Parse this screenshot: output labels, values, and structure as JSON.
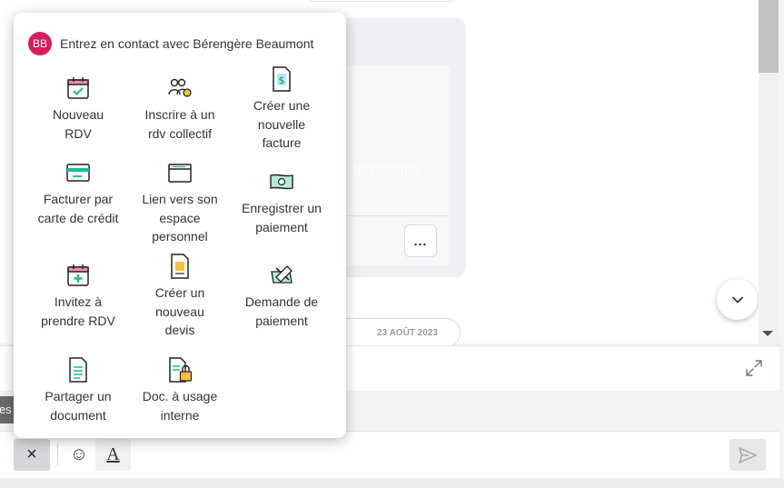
{
  "popup": {
    "avatar_initials": "BB",
    "title": "Entrez en contact avec Bérengère Beaumont",
    "items": [
      {
        "label": "Nouveau RDV",
        "icon": "calendar-check-icon"
      },
      {
        "label": "Inscrire à un rdv collectif",
        "icon": "group-users-icon"
      },
      {
        "label": "Créer une nouvelle facture",
        "icon": "invoice-dollar-icon"
      },
      {
        "label": "Facturer par carte de crédit",
        "icon": "credit-card-icon"
      },
      {
        "label": "Lien vers son espace personnel",
        "icon": "browser-window-icon"
      },
      {
        "label": "Enregistrer un paiement",
        "icon": "banknote-icon"
      },
      {
        "label": "Invitez à prendre RDV",
        "icon": "calendar-plus-icon"
      },
      {
        "label": "Créer un nouveau devis",
        "icon": "quote-document-icon"
      },
      {
        "label": "Demande de paiement",
        "icon": "payment-request-icon"
      },
      {
        "label": "Partager un document",
        "icon": "document-icon"
      },
      {
        "label": "Doc. à usage interne",
        "icon": "locked-document-icon"
      }
    ]
  },
  "chat": {
    "date_separator": "23 AOÛT 2023",
    "link_text": "Netherlands",
    "more_label": "...",
    "left_tag": "es"
  },
  "composer": {
    "close_label": "×",
    "emoji_label": "☺",
    "format_label": "A"
  },
  "colors": {
    "avatar": "#d81b60",
    "icon_teal": "#1abc9c",
    "icon_pink": "#f48fb1",
    "icon_yellow": "#f9c23c"
  }
}
